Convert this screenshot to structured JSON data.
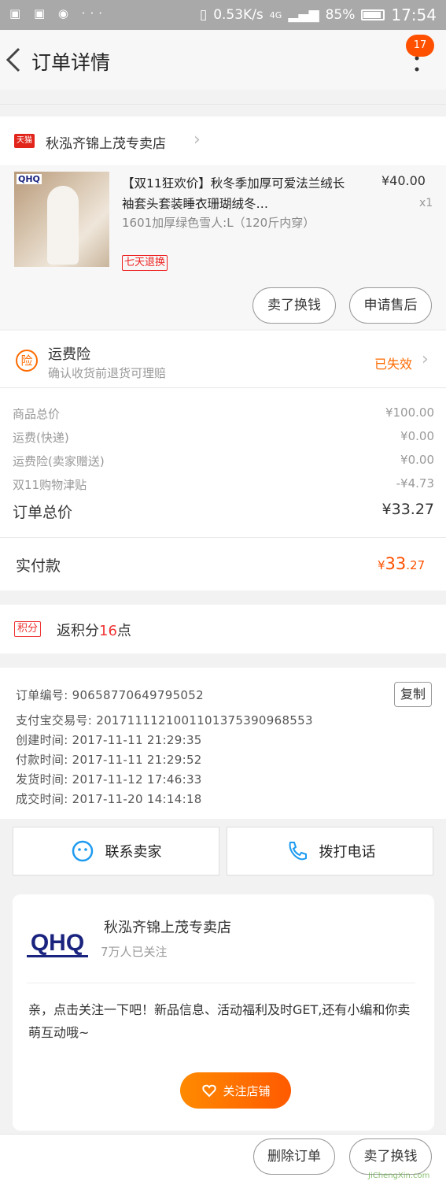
{
  "statusbar": {
    "network_speed": "0.53K/s",
    "signal": "4G",
    "battery": "85%",
    "time": "17:54"
  },
  "topbar": {
    "back_icon": "chevron-left-icon",
    "title": "订单详情",
    "more_icon": "vertical-dots-icon",
    "badge": "17"
  },
  "shop": {
    "platform_tag": "天猫",
    "name": "秋泓齐锦上茂专卖店"
  },
  "item": {
    "image_brand": "QHQ",
    "title": "【双11狂欢价】秋冬季加厚可爱法兰绒长袖套头套装睡衣珊瑚绒冬…",
    "sku": "1601加厚绿色雪人:L（120斤内穿）",
    "price": "¥40.00",
    "qty": "x1",
    "tag": "七天退换",
    "btn_exchange": "卖了换钱",
    "btn_aftersale": "申请售后"
  },
  "insurance": {
    "icon_char": "险",
    "title": "运费险",
    "subtitle": "确认收货前退货可理赔",
    "status": "已失效"
  },
  "fees": [
    {
      "label": "商品总价",
      "value": "¥100.00"
    },
    {
      "label": "运费(快递)",
      "value": "¥0.00"
    },
    {
      "label": "运费险(卖家赠送)",
      "value": "¥0.00"
    },
    {
      "label": "双11购物津贴",
      "value": "-¥4.73"
    }
  ],
  "total": {
    "label": "订单总价",
    "value": "¥33.27"
  },
  "paid": {
    "label": "实付款",
    "currency": "¥",
    "int": "33",
    "dec": ".27"
  },
  "points": {
    "tag": "积分",
    "prefix": "返积分",
    "num": "16",
    "suffix": "点"
  },
  "order": {
    "copy_label": "复制",
    "lines": [
      "订单编号: 90658770649795052",
      "支付宝交易号: 2017111121001101375390968553",
      "创建时间: 2017-11-11 21:29:35",
      "付款时间: 2017-11-11 21:29:52",
      "发货时间: 2017-11-12 17:46:33",
      "成交时间: 2017-11-20 14:14:18"
    ]
  },
  "actions": {
    "contact": "联系卖家",
    "call": "拨打电话"
  },
  "shopcard": {
    "logo_text": "QHQ",
    "name": "秋泓齐锦上茂专卖店",
    "followers": "7万人已关注",
    "message": "亲，点击关注一下吧！新品信息、活动福利及时GET,还有小编和你卖萌互动哦~",
    "follow_btn": "关注店铺"
  },
  "bottom": {
    "delete": "删除订单",
    "sell": "卖了换钱",
    "watermark": "JiChengXin.com"
  },
  "colors": {
    "accent": "#ff5000",
    "tmall_red": "#e1251b",
    "status_orange": "#ff6a00"
  }
}
